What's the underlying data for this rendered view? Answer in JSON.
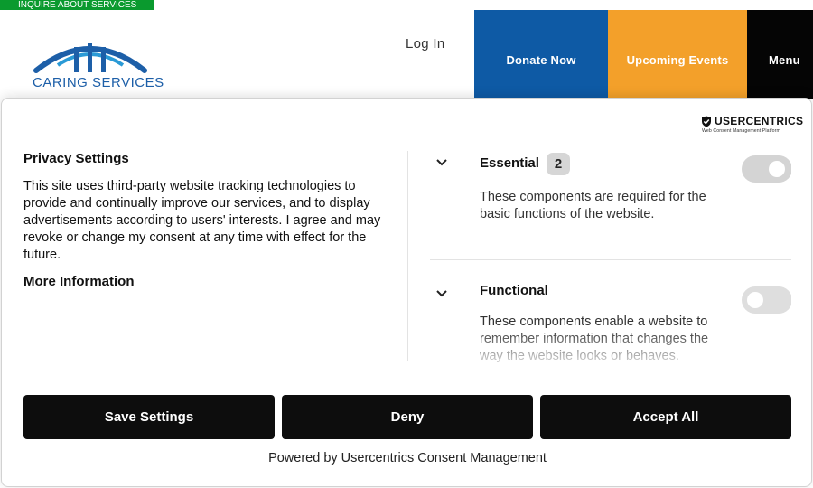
{
  "header": {
    "inquire_label": "INQUIRE ABOUT SERVICES",
    "logo_text": "CARING SERVICES",
    "login_label": "Log In",
    "donate_label": "Donate Now",
    "events_label": "Upcoming Events",
    "menu_label": "Menu",
    "colors": {
      "inquire_bg": "#0a9a2e",
      "logo_blue": "#1d5fa8",
      "donate_bg": "#0e5aa5",
      "events_bg": "#f3a02a",
      "menu_bg": "#050505"
    }
  },
  "consent": {
    "brand_name": "USERCENTRICS",
    "brand_tagline": "Web Consent Management Platform",
    "title": "Privacy Settings",
    "description": "This site uses third-party website tracking technologies to provide and continually improve our services, and to display advertisements according to users' interests. I agree and may revoke or change my consent at any time with effect for the future.",
    "more_info_label": "More Information",
    "services": [
      {
        "name": "Essential",
        "count": "2",
        "description": "These components are required for the basic functions of the website.",
        "enabled": true
      },
      {
        "name": "Functional",
        "description": "These components enable a website to remember information that changes the way the website looks or behaves.",
        "enabled": false
      }
    ],
    "buttons": {
      "save_label": "Save Settings",
      "deny_label": "Deny",
      "accept_label": "Accept All"
    },
    "powered_by": "Powered by Usercentrics Consent Management"
  }
}
